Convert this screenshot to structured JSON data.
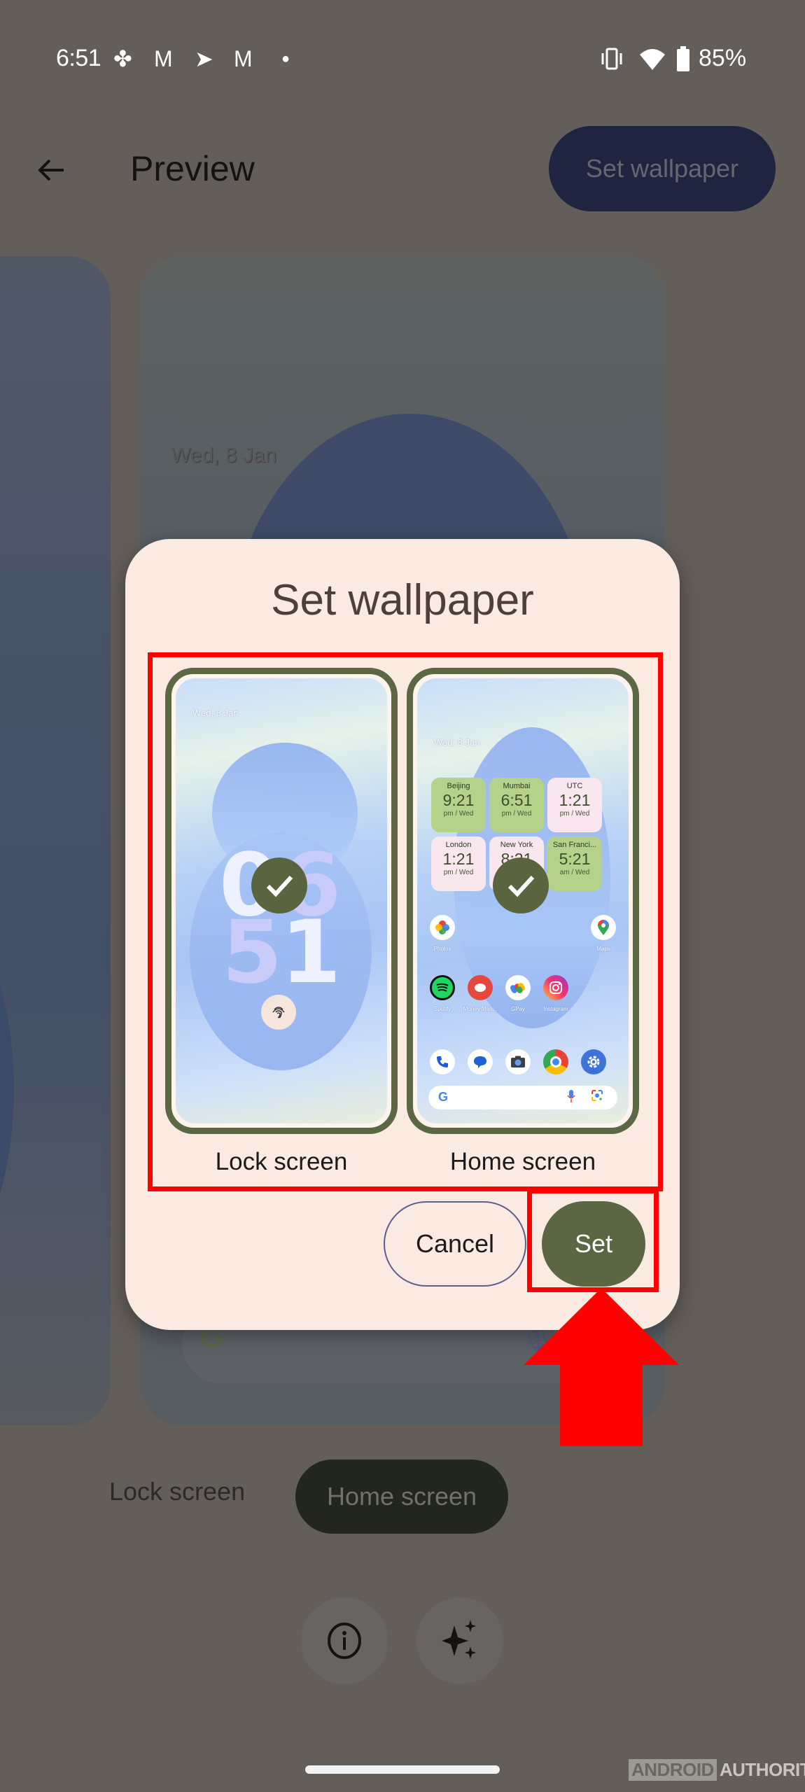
{
  "status_bar": {
    "time": "6:51",
    "left_icons": [
      "pinwheel-icon",
      "gmail-icon",
      "telegram-icon",
      "gmail-icon",
      "dot-icon"
    ],
    "right_icons": [
      "vibrate-icon",
      "wifi-icon",
      "battery-icon"
    ],
    "battery": "85%"
  },
  "app_bar": {
    "title": "Preview",
    "back_icon": "arrow-back-icon",
    "action_label": "Set wallpaper"
  },
  "background_preview": {
    "date": "Wed, 8 Jan"
  },
  "dialog": {
    "title": "Set wallpaper",
    "options": [
      {
        "label": "Lock screen",
        "selected": true
      },
      {
        "label": "Home screen",
        "selected": true
      }
    ],
    "lock_preview": {
      "date": "Wed, 8 Jan",
      "clock_digits": [
        "0",
        "6",
        "5",
        "1"
      ]
    },
    "home_preview": {
      "date": "Wed, 8 Jan",
      "world_clocks": [
        {
          "city": "Beijing",
          "time": "9:21",
          "ampm": "pm / Wed",
          "color": "green"
        },
        {
          "city": "Mumbai",
          "time": "6:51",
          "ampm": "pm / Wed",
          "color": "green"
        },
        {
          "city": "UTC",
          "time": "1:21",
          "ampm": "pm / Wed",
          "color": "pink"
        },
        {
          "city": "London",
          "time": "1:21",
          "ampm": "pm / Wed",
          "color": "pink"
        },
        {
          "city": "New York",
          "time": "8:21",
          "ampm": "pm / Wed",
          "color": "pink"
        },
        {
          "city": "San Franci...",
          "time": "5:21",
          "ampm": "am / Wed",
          "color": "green"
        }
      ],
      "apps_row1": [
        {
          "label": "Photos",
          "icon": "photos-icon"
        },
        {
          "label": "Maps",
          "icon": "maps-icon"
        }
      ],
      "apps_row2": [
        {
          "label": "Spotify",
          "icon": "spotify-icon"
        },
        {
          "label": "Money Man...",
          "icon": "money-manager-icon"
        },
        {
          "label": "GPay",
          "icon": "gpay-icon"
        },
        {
          "label": "Instagram",
          "icon": "instagram-icon"
        }
      ],
      "dock": [
        "phone-icon",
        "messages-icon",
        "camera-icon",
        "chrome-icon",
        "settings-icon"
      ]
    },
    "cancel_label": "Cancel",
    "set_label": "Set"
  },
  "bottom_tabs": [
    {
      "label": "Lock screen",
      "active": false
    },
    {
      "label": "Home screen",
      "active": true
    }
  ],
  "bottom_actions": [
    "info-icon",
    "sparkle-icon"
  ],
  "watermark": {
    "box": "ANDROID",
    "text": "AUTHORITY"
  },
  "colors": {
    "scrim": "#635e59",
    "dialog_bg": "#fbeae2",
    "primary": "#5b6742",
    "annotation": "#ff0000"
  }
}
